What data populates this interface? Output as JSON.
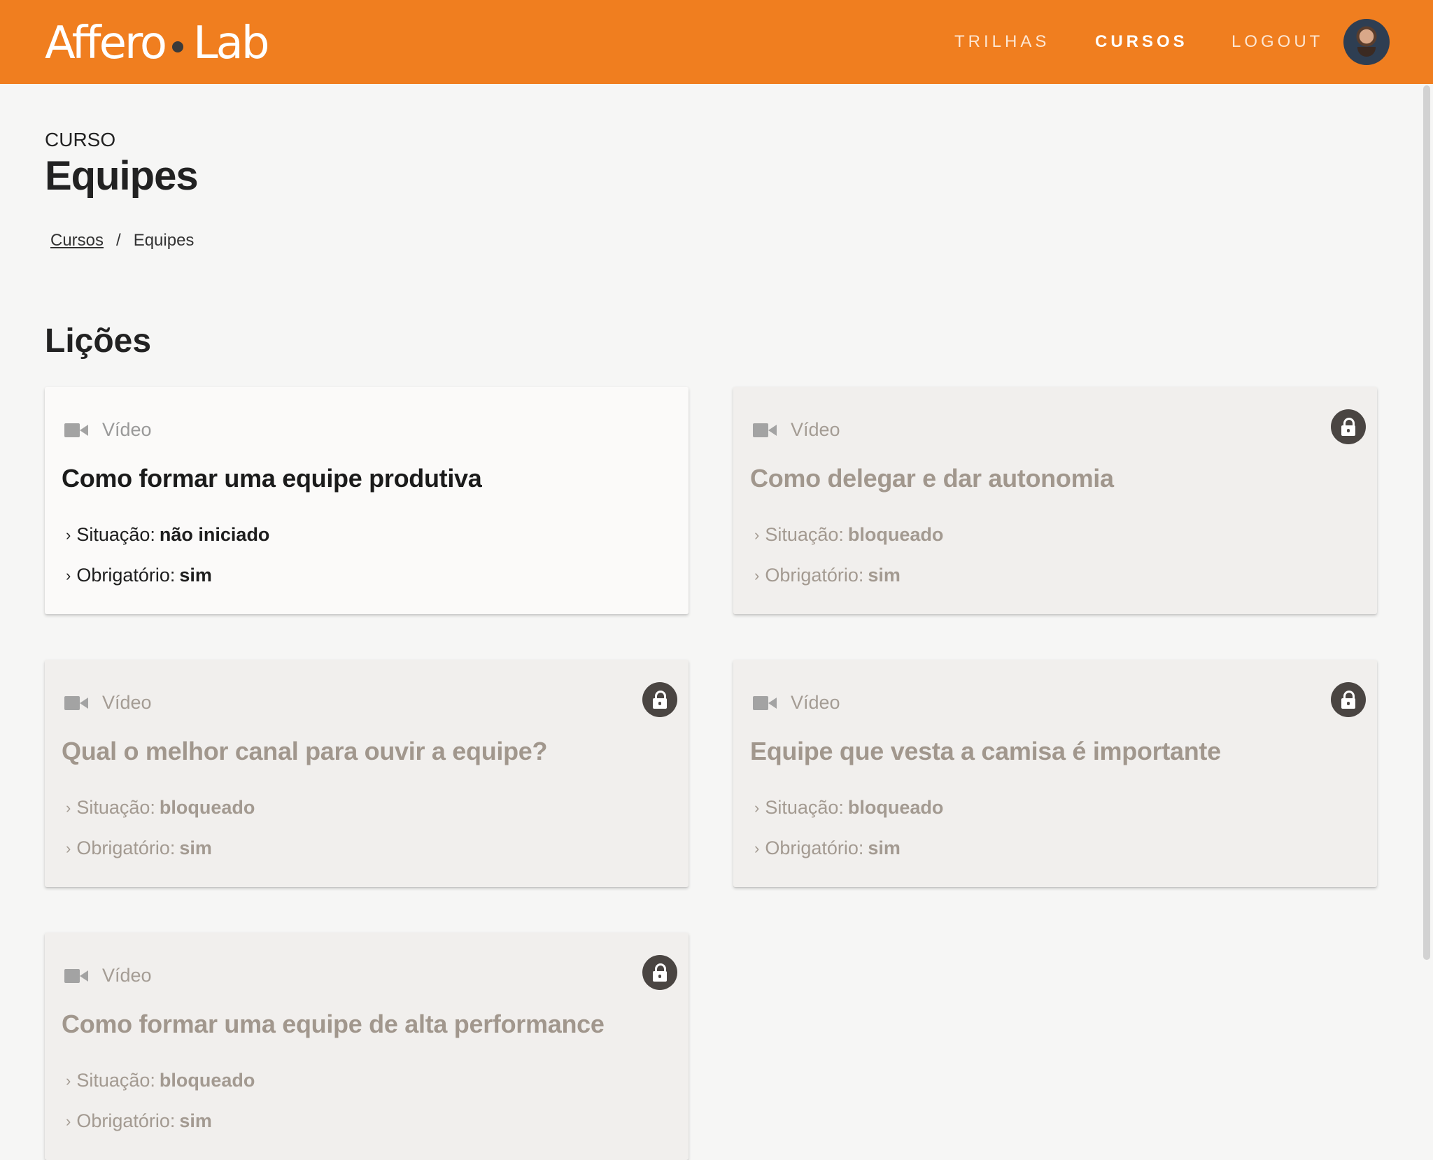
{
  "header": {
    "logo_left": "Affero",
    "logo_right": "Lab",
    "nav": [
      {
        "label": "TRILHAS"
      },
      {
        "label": "CURSOS"
      },
      {
        "label": "LOGOUT"
      }
    ],
    "brand_color": "#f07e1f"
  },
  "page": {
    "kicker": "CURSO",
    "title": "Equipes",
    "breadcrumb": {
      "link": "Cursos",
      "separator": "/",
      "current": "Equipes"
    },
    "section_title": "Lições"
  },
  "lessons": [
    {
      "type": "Vídeo",
      "title": "Como formar uma equipe produtiva",
      "status_label": "Situação:",
      "status": "não iniciado",
      "required_label": "Obrigatório:",
      "required": "sim",
      "locked": false
    },
    {
      "type": "Vídeo",
      "title": "Como delegar e dar autonomia",
      "status_label": "Situação:",
      "status": "bloqueado",
      "required_label": "Obrigatório:",
      "required": "sim",
      "locked": true
    },
    {
      "type": "Vídeo",
      "title": "Qual o melhor canal para ouvir a equipe?",
      "status_label": "Situação:",
      "status": "bloqueado",
      "required_label": "Obrigatório:",
      "required": "sim",
      "locked": true
    },
    {
      "type": "Vídeo",
      "title": "Equipe que vesta a camisa é importante",
      "status_label": "Situação:",
      "status": "bloqueado",
      "required_label": "Obrigatório:",
      "required": "sim",
      "locked": true
    },
    {
      "type": "Vídeo",
      "title": "Como formar uma equipe de alta performance",
      "status_label": "Situação:",
      "status": "bloqueado",
      "required_label": "Obrigatório:",
      "required": "sim",
      "locked": true
    }
  ],
  "icons": {
    "lesson_type": "video-camera-icon",
    "lock": "lock-icon",
    "bullet": "chevron-right-icon"
  }
}
